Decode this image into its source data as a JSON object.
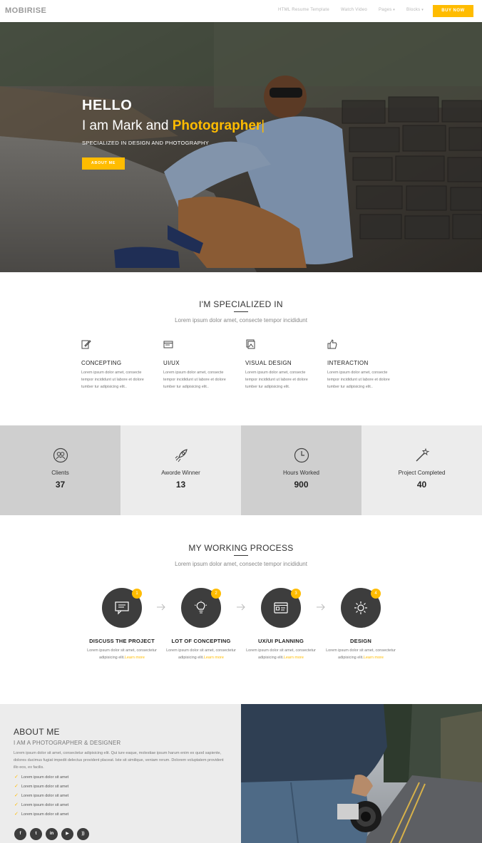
{
  "nav": {
    "brand": "MOBIRISE",
    "links": [
      "HTML Resume Template",
      "Watch Video",
      "Pages",
      "Blocks"
    ],
    "cta": "BUY NOW"
  },
  "hero": {
    "hello": "HELLO",
    "intro": "I am Mark and",
    "role": "Photographer",
    "cursor": "|",
    "subtitle": "SPECIALIZED IN DESIGN AND PHOTOGRAPHY",
    "button": "ABOUT ME"
  },
  "specialized": {
    "title": "I'M SPECIALIZED IN",
    "subtitle": "Lorem ipsum dolor amet, consecte tempor incididunt",
    "items": [
      {
        "icon": "edit-icon",
        "title": "CONCEPTING",
        "text": "Lorem ipsum dolor amet, consecte tempor incididunt ut labore et dolore tumber tur adipisicing elit.."
      },
      {
        "icon": "window-icon",
        "title": "UI/UX",
        "text": "Lorem ipsum dolor amet, consecte tempor incididunt ut labore et dolore tumber tur adipisicing elit.."
      },
      {
        "icon": "image-stack-icon",
        "title": "VISUAL DESIGN",
        "text": "Lorem ipsum dolor amet, consecte tempor incididunt ut labore et dolore tumber tur adipisicing elit."
      },
      {
        "icon": "thumbs-up-icon",
        "title": "INTERACTION",
        "text": "Lorem ipsum dolor amet, consecte tempor incididunt ut labore et dolore tumber tur adipisicing elit.."
      }
    ]
  },
  "stats": [
    {
      "icon": "users-icon",
      "label": "Clients",
      "value": "37"
    },
    {
      "icon": "rocket-icon",
      "label": "Aworde Winner",
      "value": "13"
    },
    {
      "icon": "clock-icon",
      "label": "Hours Worked",
      "value": "900"
    },
    {
      "icon": "magic-wand-icon",
      "label": "Project Completed",
      "value": "40"
    }
  ],
  "process": {
    "title": "MY WORKING PROCESS",
    "subtitle": "Lorem ipsum dolor amet, consecte tempor incididunt",
    "steps": [
      {
        "num": "1",
        "icon": "chat-icon",
        "title": "DISCUSS THE PROJECT",
        "text": "Lorem ipsum dolor sit amet, consectetur adipisicing elit.",
        "more": "Learn more"
      },
      {
        "num": "2",
        "icon": "lightbulb-icon",
        "title": "LOT OF CONCEPTING",
        "text": "Lorem ipsum dolor sit amet, consectetur adipisicing elit.",
        "more": "Learn more"
      },
      {
        "num": "3",
        "icon": "id-card-icon",
        "title": "UX/UI PLANNING",
        "text": "Lorem ipsum dolor sit amet, consectetur adipisicing elit.",
        "more": "Learn more"
      },
      {
        "num": "4",
        "icon": "sun-icon",
        "title": "DESIGN",
        "text": "Lorem ipsum dolor sit amet, consectetur adipisicing elit.",
        "more": "Learn more"
      }
    ]
  },
  "about": {
    "title": "ABOUT ME",
    "subtitle": "I AM A PHOTOGRAPHER & DESIGNER",
    "text": "Lorem ipsum dolor sit amet, consectetur adipisicing elit. Qui iure eaque, molestiae ipsum harum enim ex quod sapiente, dolores ducimus fugiat impedit delectus provident placeat. Iste sit similique, veniam rerum. Dolorem voluptatem provident illo eos, ex facilis.",
    "list": [
      "Lorem ipsum dolor sit amet",
      "Lorem ipsum dolor sit amet",
      "Lorem ipsum dolor sit amet",
      "Lorem ipsum dolor sit amet",
      "Lorem ipsum dolor sit amet"
    ],
    "social": [
      {
        "icon": "facebook-icon",
        "glyph": "f"
      },
      {
        "icon": "twitter-icon",
        "glyph": "t"
      },
      {
        "icon": "linkedin-icon",
        "glyph": "in"
      },
      {
        "icon": "youtube-icon",
        "glyph": "▶"
      },
      {
        "icon": "rss-icon",
        "glyph": "))"
      }
    ]
  },
  "colors": {
    "accent": "#ffbc00",
    "dark": "#3d3d3d",
    "stat_dark": "#cfcfcf",
    "stat_light": "#ececec"
  }
}
